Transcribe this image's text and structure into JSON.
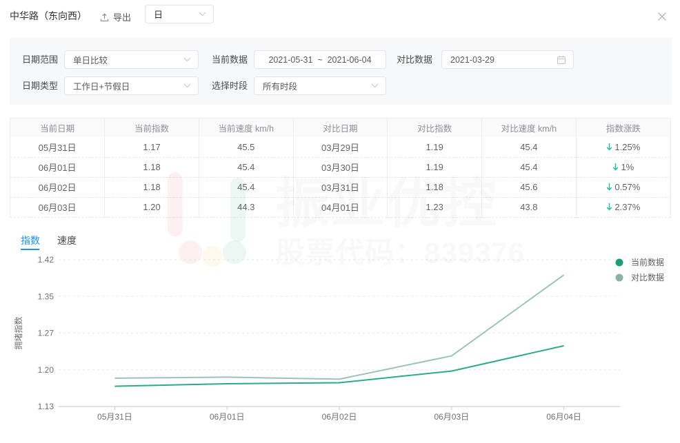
{
  "header": {
    "title": "中华路（东向西）",
    "export_label": "导出",
    "unit_select_value": "日"
  },
  "filters": {
    "date_range_label": "日期范围",
    "date_range_value": "单日比较",
    "current_data_label": "当前数据",
    "current_data_value": "2021-05-31  ~  2021-06-04",
    "compare_data_label": "对比数据",
    "compare_data_value": "2021-03-29",
    "date_type_label": "日期类型",
    "date_type_value": "工作日+节假日",
    "time_period_label": "选择时段",
    "time_period_value": "所有时段"
  },
  "table": {
    "headers": [
      "当前日期",
      "当前指数",
      "当前速度 km/h",
      "对比日期",
      "对比指数",
      "对比速度 km/h",
      "指数涨跌"
    ],
    "rows": [
      {
        "cur_date": "05月31日",
        "cur_idx": "1.17",
        "cur_speed": "45.5",
        "cmp_date": "03月29日",
        "cmp_idx": "1.19",
        "cmp_speed": "45.4",
        "change": "1.25%"
      },
      {
        "cur_date": "06月01日",
        "cur_idx": "1.18",
        "cur_speed": "45.4",
        "cmp_date": "03月30日",
        "cmp_idx": "1.19",
        "cmp_speed": "45.4",
        "change": "1%"
      },
      {
        "cur_date": "06月02日",
        "cur_idx": "1.18",
        "cur_speed": "45.4",
        "cmp_date": "03月31日",
        "cmp_idx": "1.18",
        "cmp_speed": "45.6",
        "change": "0.57%"
      },
      {
        "cur_date": "06月03日",
        "cur_idx": "1.20",
        "cur_speed": "44.3",
        "cmp_date": "04月01日",
        "cmp_idx": "1.23",
        "cmp_speed": "43.8",
        "change": "2.37%"
      }
    ],
    "change_direction": "down"
  },
  "tabs": {
    "index_tab": "指数",
    "speed_tab": "速度"
  },
  "chart_data": {
    "type": "line",
    "title": "",
    "ylabel": "拥堵指数",
    "categories": [
      "05月31日",
      "06月01日",
      "06月02日",
      "06月03日",
      "06月04日"
    ],
    "series": [
      {
        "name": "当前数据",
        "color": "#2cab86",
        "dot_color": "#1f9d77",
        "values": [
          1.17,
          1.175,
          1.177,
          1.2,
          1.25
        ]
      },
      {
        "name": "对比数据",
        "color": "#9dc3b6",
        "dot_color": "#8fb0a5",
        "values": [
          1.186,
          1.188,
          1.184,
          1.23,
          1.39
        ]
      }
    ],
    "ylim": [
      1.13,
      1.42
    ],
    "yticks": [
      "1.13",
      "1.20",
      "1.27",
      "1.35",
      "1.42"
    ],
    "grid": "dashed",
    "legend_position": "right"
  },
  "watermark": {
    "brand_text": "振业优控",
    "stock_text": "股票代码：839376"
  }
}
